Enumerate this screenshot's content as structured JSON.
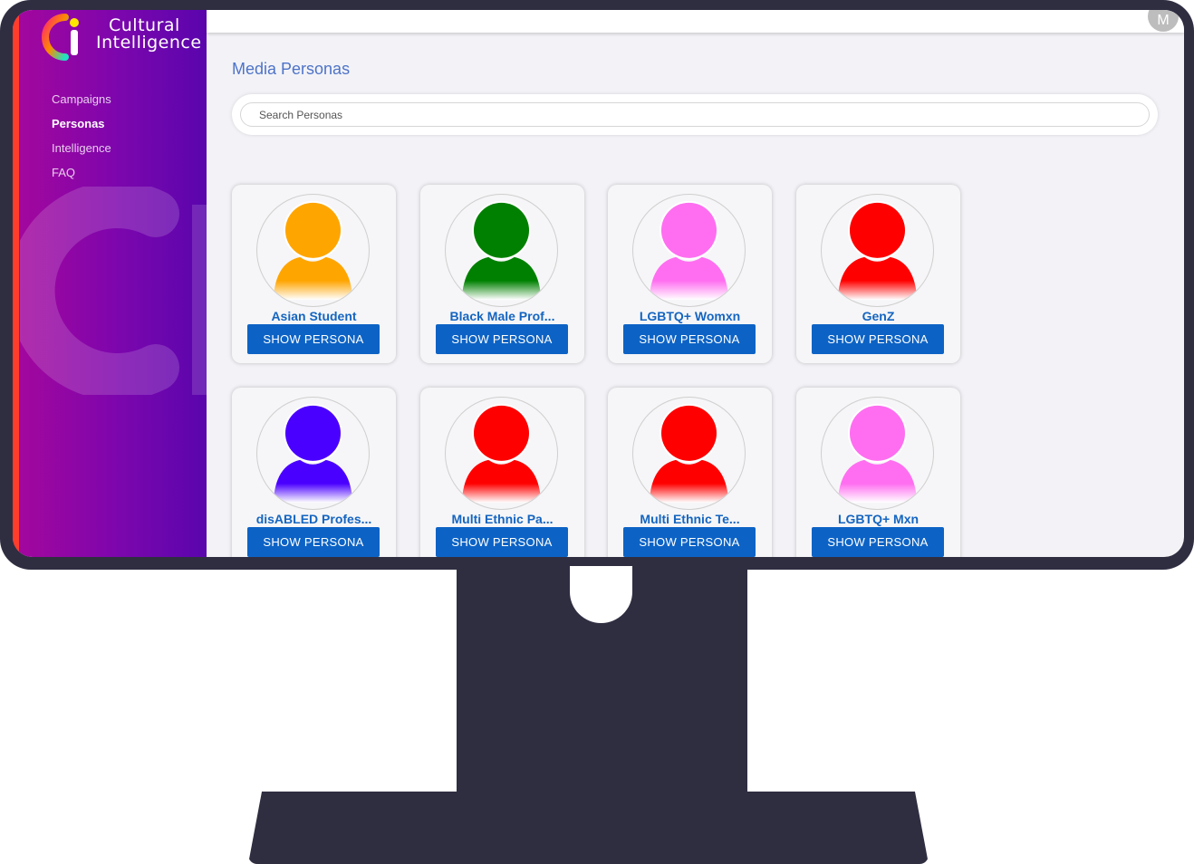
{
  "app": {
    "logo_line1": "Cultural",
    "logo_line2": "Intelligence",
    "user_initial": "M"
  },
  "sidebar": {
    "items": [
      {
        "label": "Campaigns",
        "active": false
      },
      {
        "label": "Personas",
        "active": true
      },
      {
        "label": "Intelligence",
        "active": false
      },
      {
        "label": "FAQ",
        "active": false
      }
    ]
  },
  "main": {
    "title": "Media Personas",
    "search_placeholder": "Search Personas",
    "button_label": "SHOW PERSONA"
  },
  "personas": [
    {
      "name": "Asian Student",
      "color": "#ffa500"
    },
    {
      "name": "Black Male Prof...",
      "color": "#008000"
    },
    {
      "name": "LGBTQ+ Womxn",
      "color": "#ff6ef0"
    },
    {
      "name": "GenZ",
      "color": "#ff0000"
    },
    {
      "name": "disABLED Profes...",
      "color": "#4a00ff"
    },
    {
      "name": "Multi Ethnic Pa...",
      "color": "#ff0000"
    },
    {
      "name": "Multi Ethnic Te...",
      "color": "#ff0000"
    },
    {
      "name": "LGBTQ+ Mxn",
      "color": "#ff6ef0"
    }
  ],
  "colors": {
    "accent_blue": "#0d63c5",
    "title_blue": "#4e73c8",
    "monitor": "#2f2e41",
    "sidebar_stripe": "#ff3d2a"
  }
}
